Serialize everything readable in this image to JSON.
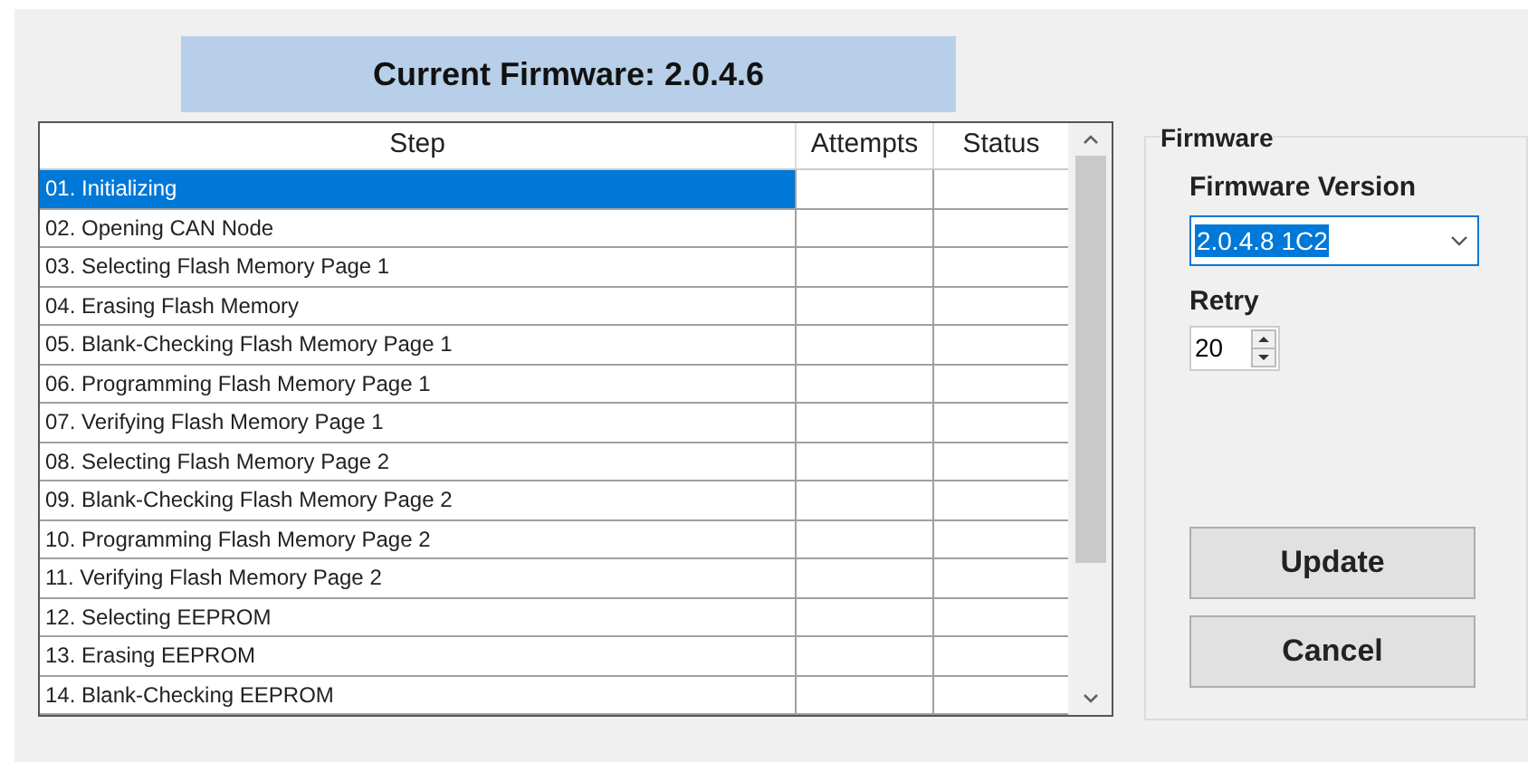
{
  "banner": {
    "text": "Current Firmware: 2.0.4.6"
  },
  "table": {
    "columns": [
      "Step",
      "Attempts",
      "Status"
    ],
    "rows": [
      {
        "step": "01. Initializing",
        "selected": true
      },
      {
        "step": "02. Opening CAN Node",
        "selected": false
      },
      {
        "step": "03. Selecting Flash Memory Page 1",
        "selected": false
      },
      {
        "step": "04. Erasing Flash Memory",
        "selected": false
      },
      {
        "step": "05. Blank-Checking Flash Memory Page 1",
        "selected": false
      },
      {
        "step": "06. Programming Flash Memory Page 1",
        "selected": false
      },
      {
        "step": "07. Verifying Flash Memory Page 1",
        "selected": false
      },
      {
        "step": "08. Selecting Flash Memory Page 2",
        "selected": false
      },
      {
        "step": "09. Blank-Checking Flash Memory Page 2",
        "selected": false
      },
      {
        "step": "10. Programming Flash Memory Page 2",
        "selected": false
      },
      {
        "step": "11. Verifying Flash Memory Page 2",
        "selected": false
      },
      {
        "step": "12. Selecting EEPROM",
        "selected": false
      },
      {
        "step": "13. Erasing EEPROM",
        "selected": false
      },
      {
        "step": "14. Blank-Checking EEPROM",
        "selected": false
      }
    ]
  },
  "group": {
    "title": "Firmware",
    "version_label": "Firmware Version",
    "version": {
      "value": "2.0.4.8 1C2",
      "highlighted": true
    },
    "retry_label": "Retry",
    "retry": {
      "value": "20"
    },
    "buttons": [
      "Update",
      "Cancel"
    ]
  }
}
